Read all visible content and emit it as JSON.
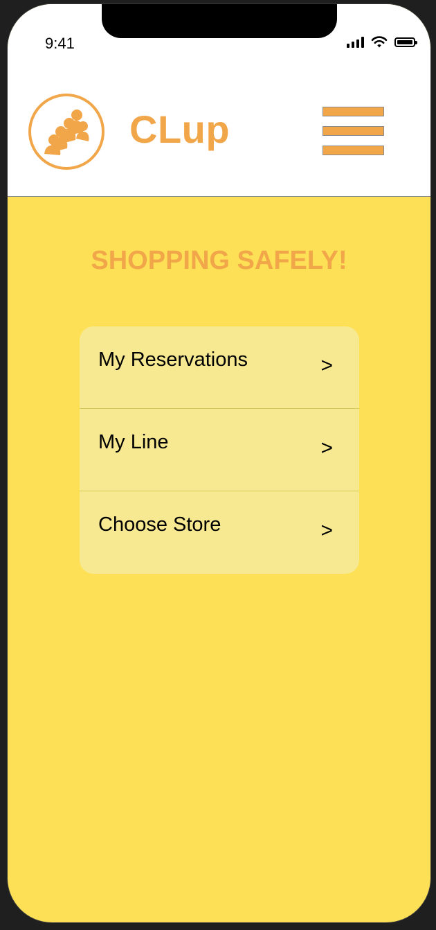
{
  "status_bar": {
    "time": "9:41"
  },
  "header": {
    "app_name": "CLup",
    "logo_icon": "group-of-people-icon",
    "menu_icon": "hamburger-menu-icon"
  },
  "main": {
    "tagline": "SHOPPING SAFELY!",
    "menu": [
      {
        "label": "My Reservations",
        "chevron": ">"
      },
      {
        "label": "My Line",
        "chevron": ">"
      },
      {
        "label": "Choose Store",
        "chevron": ">"
      }
    ]
  },
  "colors": {
    "accent": "#f2a64a",
    "background": "#fde055",
    "card": "#f7e992",
    "header": "#ffffff"
  }
}
